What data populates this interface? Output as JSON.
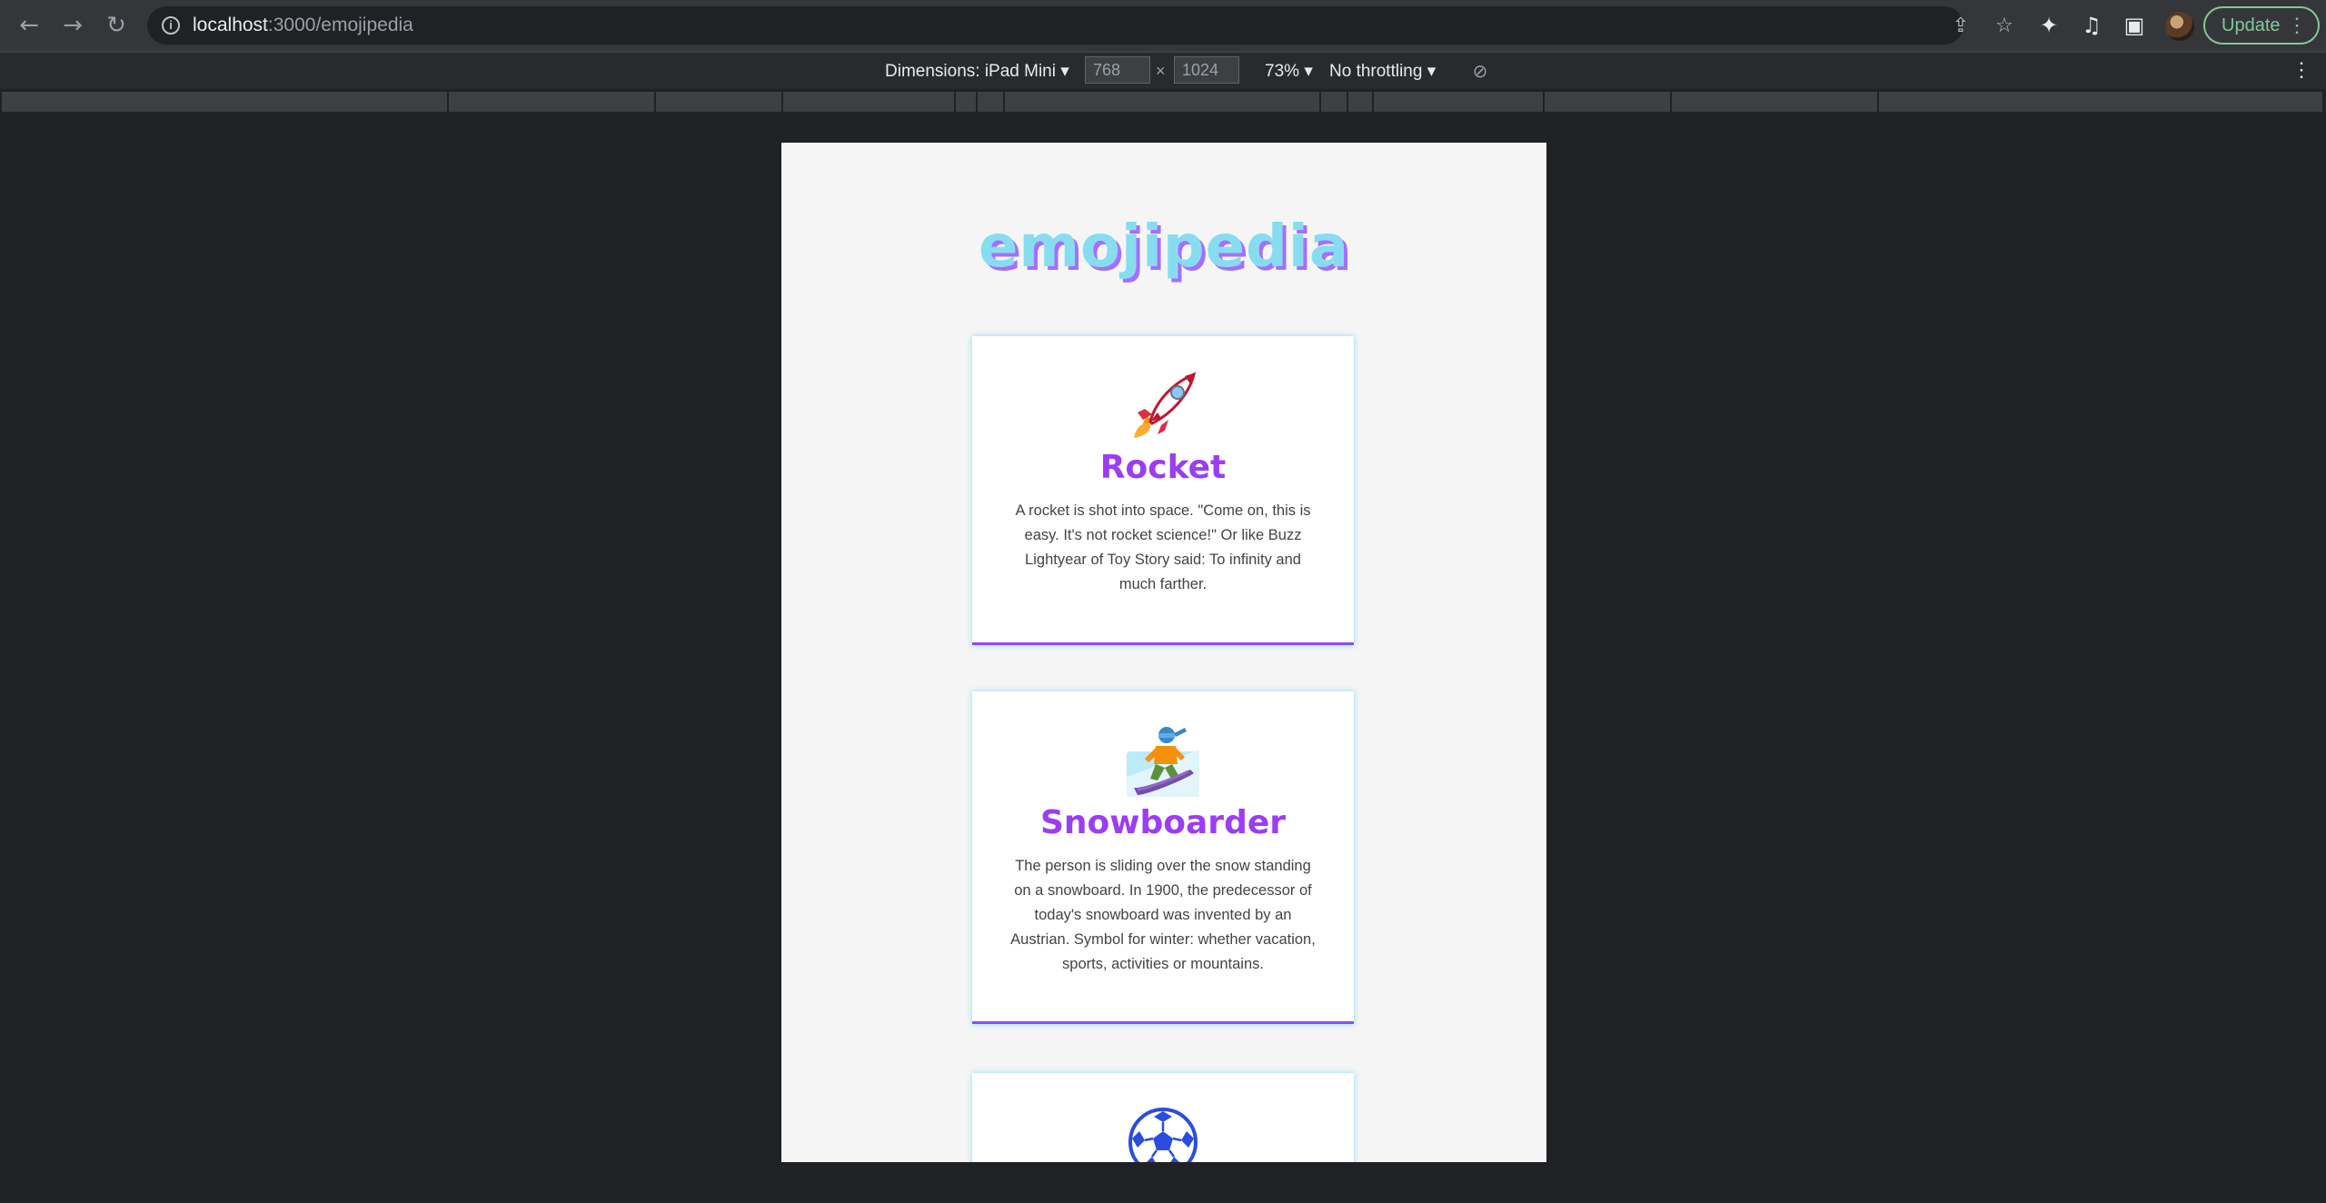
{
  "browser": {
    "url_host": "localhost",
    "url_path": ":3000/emojipedia",
    "update_label": "Update",
    "icons": [
      "back-icon",
      "forward-icon",
      "reload-icon",
      "info-icon",
      "share-icon",
      "star-icon",
      "extensions-icon",
      "media-icon",
      "sidepanel-icon",
      "kebab-icon"
    ]
  },
  "device_toolbar": {
    "dimensions_label": "Dimensions: iPad Mini",
    "width": "768",
    "height": "1024",
    "zoom": "73%",
    "throttling": "No throttling"
  },
  "page": {
    "title": "emojipedia",
    "colors": {
      "title": "#87ddf0",
      "title_shadow": "#a56eff",
      "card_title": "#9b3df5",
      "card_border": "#8a4dff"
    },
    "cards": [
      {
        "name": "Rocket",
        "emoji": "rocket",
        "description": "A rocket is shot into space. \"Come on, this is easy. It's not rocket science!\" Or like Buzz Lightyear of Toy Story said: To infinity and much farther."
      },
      {
        "name": "Snowboarder",
        "emoji": "snowboarder",
        "description": "The person is sliding over the snow standing on a snowboard. In 1900, the predecessor of today's snowboard was invented by an Austrian. Symbol for winter: whether vacation, sports, activities or mountains."
      },
      {
        "name": "",
        "emoji": "soccer-ball",
        "description": ""
      }
    ]
  }
}
